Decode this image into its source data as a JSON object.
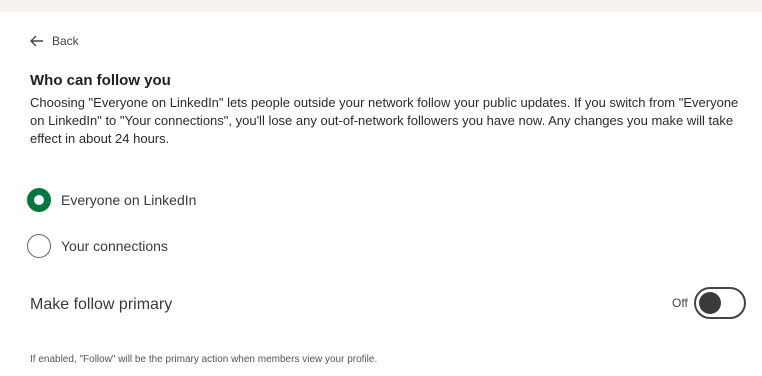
{
  "nav": {
    "back_label": "Back"
  },
  "section": {
    "title": "Who can follow you",
    "description": "Choosing \"Everyone on LinkedIn\" lets people outside your network follow your public updates. If you switch from \"Everyone on LinkedIn\" to \"Your connections\", you'll lose any out-of-network followers you have now. Any changes you make will take effect in about 24 hours."
  },
  "options": [
    {
      "label": "Everyone on LinkedIn",
      "selected": true
    },
    {
      "label": "Your connections",
      "selected": false
    }
  ],
  "follow_primary": {
    "label": "Make follow primary",
    "state_label": "Off",
    "enabled": false,
    "note": "If enabled, \"Follow\" will be the primary action when members view your profile."
  },
  "colors": {
    "accent": "#057642",
    "background": "#ffffff"
  }
}
